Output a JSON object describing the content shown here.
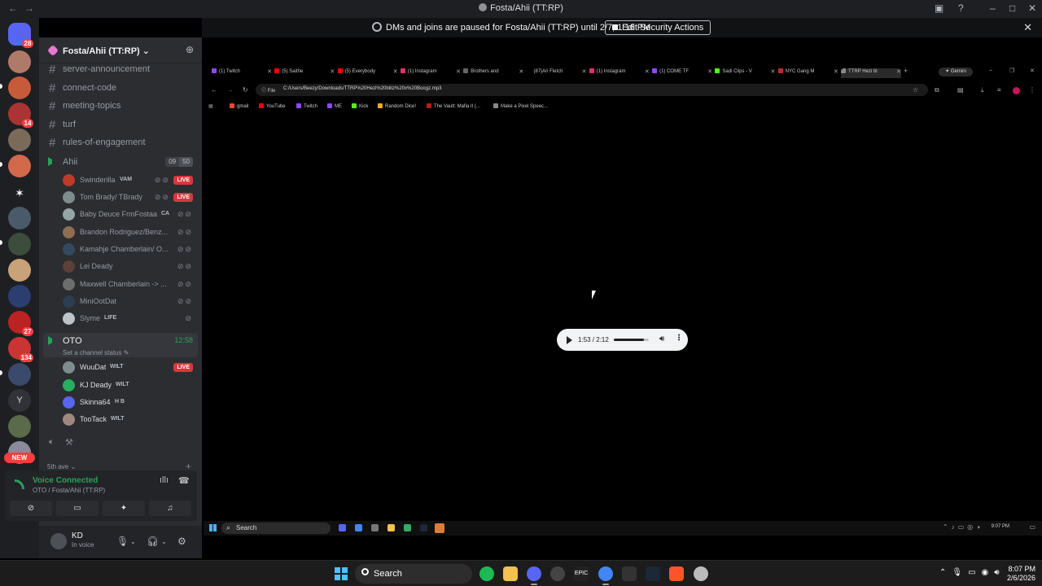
{
  "window": {
    "title": "Fosta/Ahii (TT:RP)"
  },
  "notice": {
    "text": "DMs and joins are paused for Fosta/Ahii (TT:RP) until 2/7, 1:16 PM",
    "button": "Edit Security Actions"
  },
  "rail": {
    "dm_badge": "28",
    "badges": [
      "14",
      "27",
      "134"
    ],
    "letter": "Y",
    "new_label": "NEW"
  },
  "server": {
    "name": "Fosta/Ahii (TT:RP)"
  },
  "channels": [
    "server-announcement",
    "connect-code",
    "meeting-topics",
    "turf",
    "rules-of-engagement"
  ],
  "voice_channels": [
    {
      "name": "Ahii",
      "count": "09",
      "limit": "50",
      "users": [
        {
          "name": "Swinderilla",
          "tag": "VAM",
          "live": "LIVE",
          "color": "#c0392b"
        },
        {
          "name": "Tom Brady/ TBrady",
          "live": "LIVE",
          "color": "#7f8c8d"
        },
        {
          "name": "Baby Deuce FrmFostaa",
          "tag": "CA",
          "color": "#95a5a6"
        },
        {
          "name": "Brandon Rodriguez/Benz...",
          "color": "#8e6e53"
        },
        {
          "name": "Kamahje Chamberlain/ O...",
          "color": "#34495e"
        },
        {
          "name": "Lei Deady",
          "color": "#5d4037"
        },
        {
          "name": "Maxwell Chamberlain -> ...",
          "color": "#6d6d6d"
        },
        {
          "name": "MiniOotDat",
          "color": "#2c3e50"
        },
        {
          "name": "Slyme",
          "tag": "LIFE",
          "color": "#bdc3c7"
        }
      ]
    },
    {
      "name": "OTO",
      "time": "12:58",
      "status": "Set a channel status",
      "users": [
        {
          "name": "WuuDat",
          "tag": "WILT",
          "live": "LIVE",
          "color": "#7f8c8d"
        },
        {
          "name": "KJ Deady",
          "tag": "WILT",
          "color": "#27ae60"
        },
        {
          "name": "Skinna64",
          "tag": "H B",
          "color": "#5865f2"
        },
        {
          "name": "TooTack",
          "tag": "WILT",
          "color": "#a1887f"
        }
      ]
    }
  ],
  "category": "5th ave",
  "voice_panel": {
    "status": "Voice Connected",
    "location": "OTO / Fosta/Ahii (TT:RP)"
  },
  "user_panel": {
    "name": "KD",
    "status": "In voice"
  },
  "browser": {
    "tabs": [
      "(1) Twitch",
      "(5) Saithe",
      "(5) Everybody",
      "(1) Instagram",
      "Brothers and",
      "(87)Ari Fletch",
      "(1) Instagram",
      "(1) COME TF",
      "Sadi Clips - V",
      "NYC Gang M",
      "TTRP Hezi bl"
    ],
    "gemini": "Gemini",
    "url_prefix": "File",
    "url": "C:/Users/Beezy/Downloads/TTRP%20Hezi%20blitz%20x%20Boogz.mp3",
    "bookmarks": [
      "gmail",
      "YouTube",
      "Twitch",
      "ME",
      "Kick",
      "Random Dice!",
      "The Vault: Mafia II (...",
      "Make a Pixel Speec..."
    ],
    "player_time": "1:53 / 2:12",
    "player_progress": 0.86
  },
  "inner_taskbar": {
    "search": "Search",
    "clock": "9:07 PM"
  },
  "taskbar": {
    "search": "Search",
    "time": "8:07 PM",
    "date": "2/6/2026"
  }
}
